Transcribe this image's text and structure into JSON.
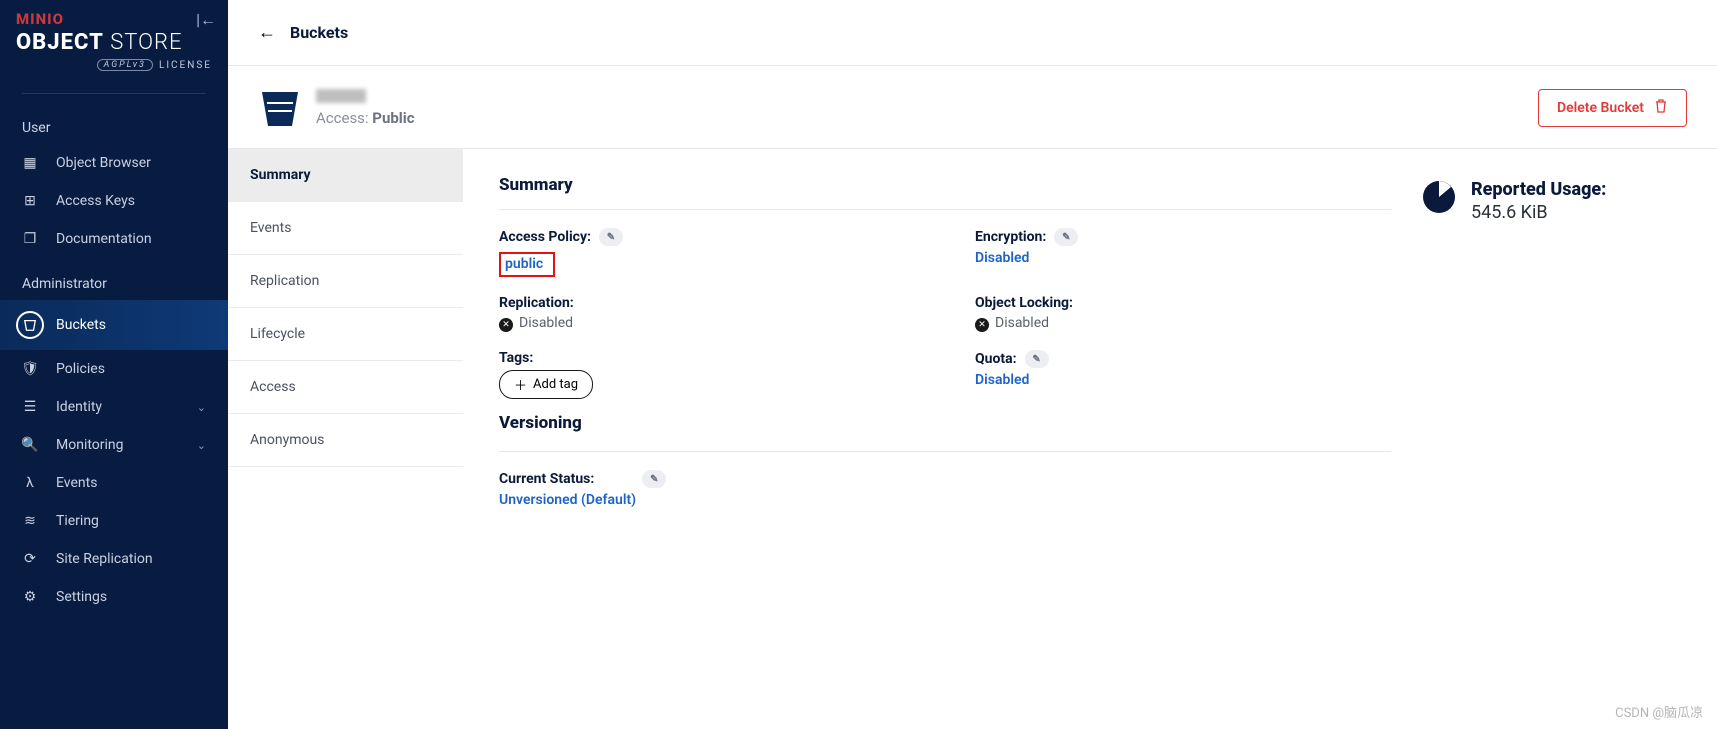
{
  "brand": {
    "top": "MINIO",
    "main_bold": "OBJECT",
    "main_light": "STORE",
    "license": "LICENSE",
    "badge": "AGPLv3"
  },
  "nav": {
    "section1": "User",
    "section2": "Administrator",
    "items_user": [
      {
        "label": "Object Browser",
        "icon": "▦"
      },
      {
        "label": "Access Keys",
        "icon": "⊞"
      },
      {
        "label": "Documentation",
        "icon": "❐"
      }
    ],
    "items_admin": [
      {
        "label": "Buckets",
        "icon": "▭",
        "active": true
      },
      {
        "label": "Policies",
        "icon": "🛡"
      },
      {
        "label": "Identity",
        "icon": "☰",
        "expandable": true
      },
      {
        "label": "Monitoring",
        "icon": "🔍",
        "expandable": true
      },
      {
        "label": "Events",
        "icon": "λ"
      },
      {
        "label": "Tiering",
        "icon": "≋"
      },
      {
        "label": "Site Replication",
        "icon": "⟳"
      },
      {
        "label": "Settings",
        "icon": "⚙"
      }
    ]
  },
  "header": {
    "title": "Buckets"
  },
  "bucket": {
    "access_label": "Access:",
    "access_value": "Public",
    "delete_label": "Delete Bucket"
  },
  "tabs": [
    "Summary",
    "Events",
    "Replication",
    "Lifecycle",
    "Access",
    "Anonymous"
  ],
  "summary": {
    "title": "Summary",
    "access_policy_label": "Access Policy:",
    "access_policy_value": "public",
    "replication_label": "Replication:",
    "replication_value": "Disabled",
    "tags_label": "Tags:",
    "add_tag": "Add tag",
    "encryption_label": "Encryption:",
    "encryption_value": "Disabled",
    "object_locking_label": "Object Locking:",
    "object_locking_value": "Disabled",
    "quota_label": "Quota:",
    "quota_value": "Disabled"
  },
  "versioning": {
    "title": "Versioning",
    "status_label": "Current Status:",
    "status_value": "Unversioned (Default)"
  },
  "usage": {
    "label": "Reported Usage:",
    "value": "545.6 KiB"
  },
  "watermark": "CSDN @脑瓜凉"
}
